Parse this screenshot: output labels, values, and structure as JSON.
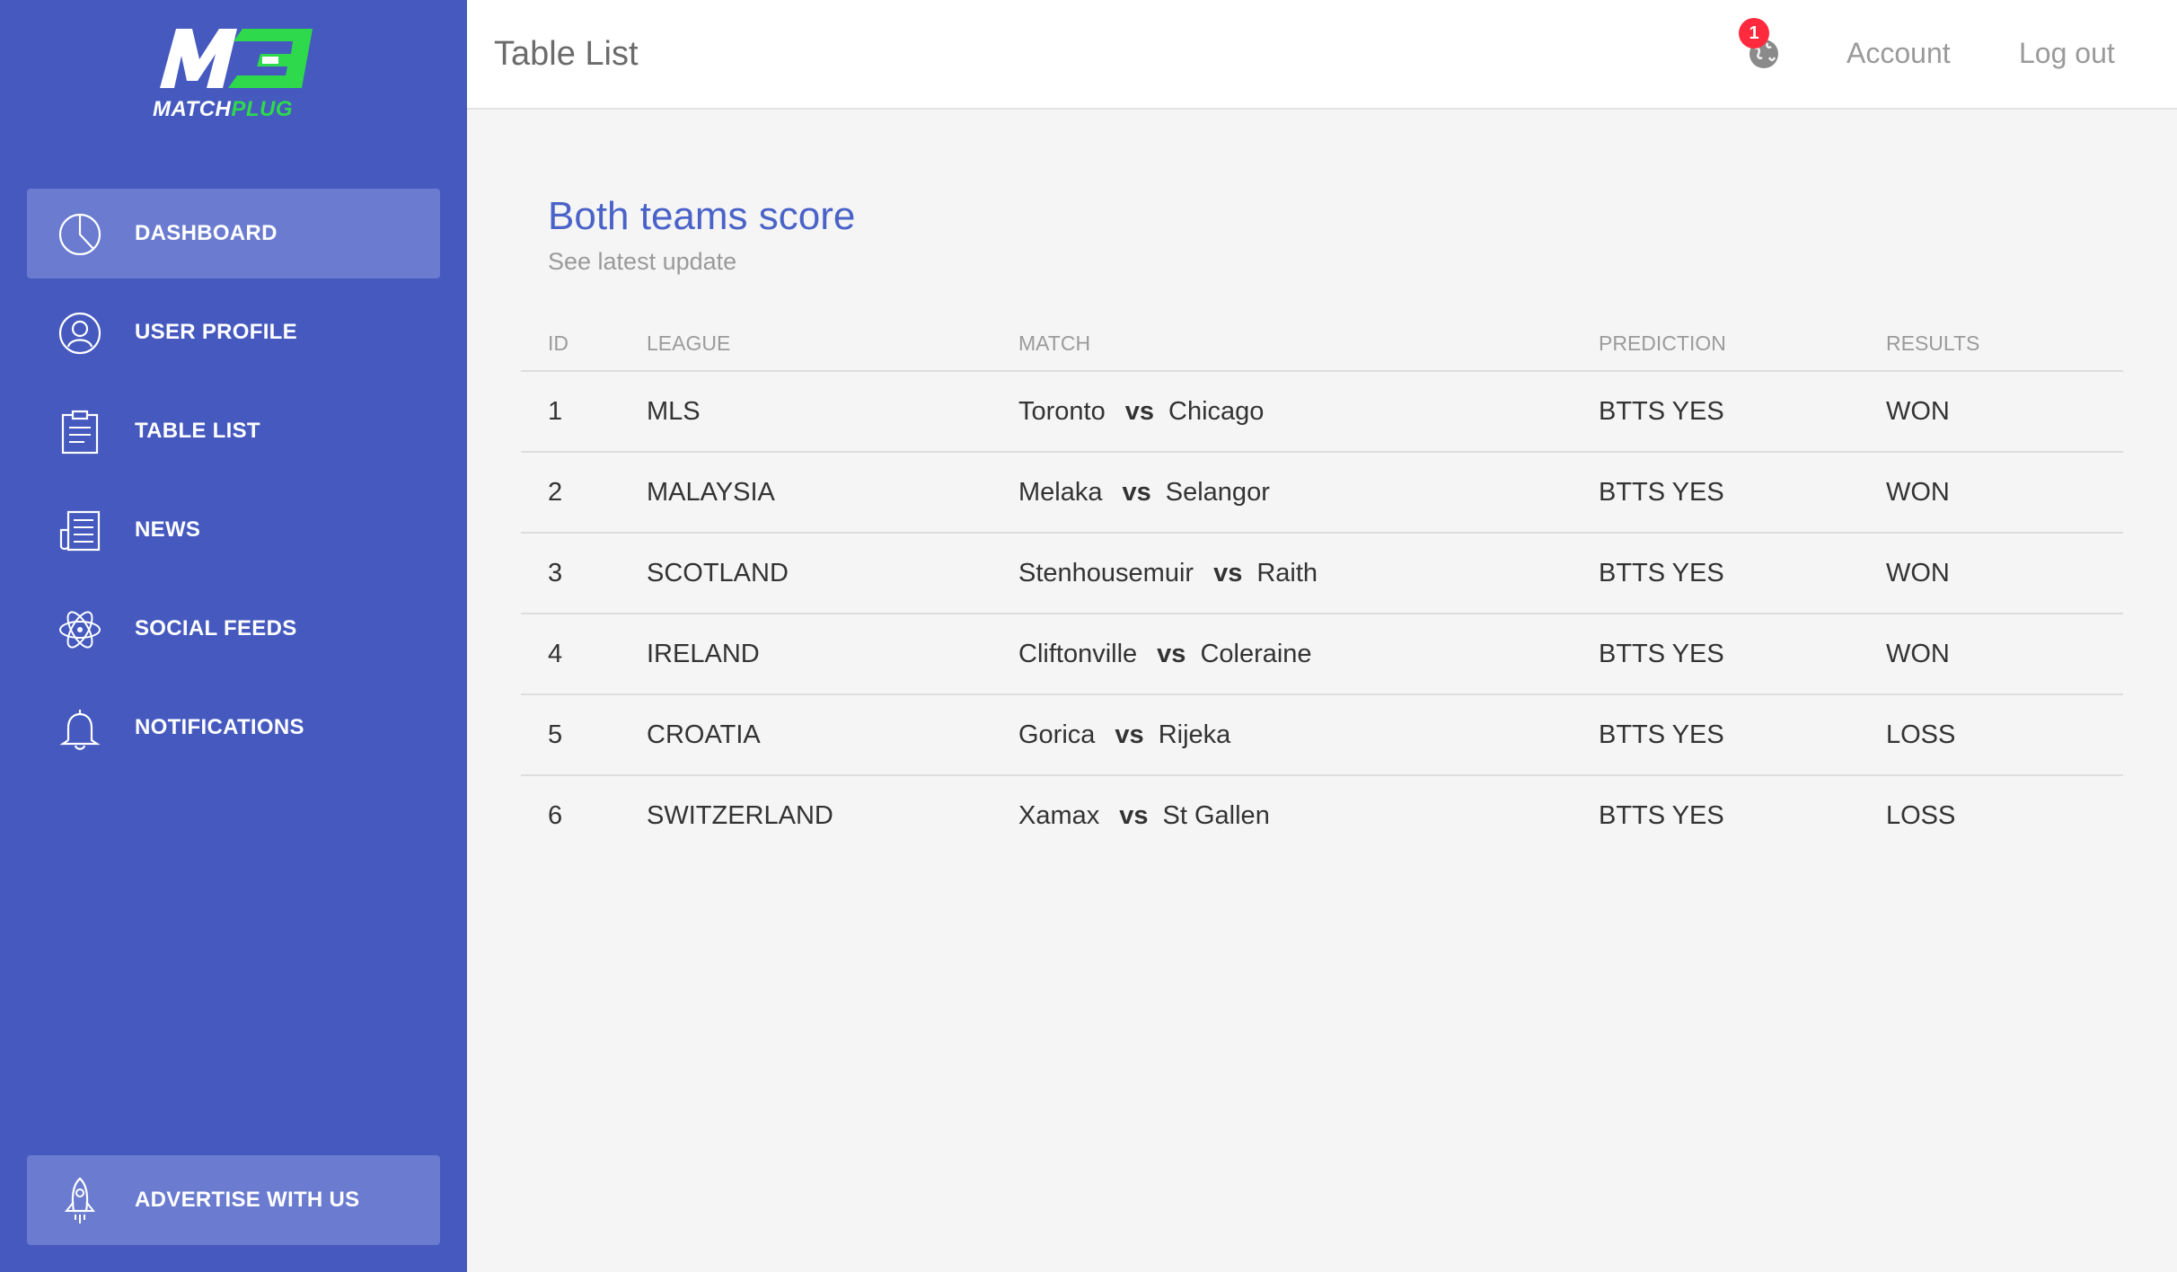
{
  "sidebar": {
    "logo": {
      "brand_part1": "MATCH",
      "brand_part2": "PLUG"
    },
    "items": [
      {
        "label": "DASHBOARD",
        "icon": "pie-chart-icon",
        "active": true
      },
      {
        "label": "USER PROFILE",
        "icon": "user-icon",
        "active": false
      },
      {
        "label": "TABLE LIST",
        "icon": "clipboard-icon",
        "active": false
      },
      {
        "label": "NEWS",
        "icon": "newspaper-icon",
        "active": false
      },
      {
        "label": "SOCIAL FEEDS",
        "icon": "atom-icon",
        "active": false
      },
      {
        "label": "NOTIFICATIONS",
        "icon": "bell-icon",
        "active": false
      }
    ],
    "advertise": {
      "label": "ADVERTISE WITH US",
      "icon": "rocket-icon"
    }
  },
  "header": {
    "title": "Table List",
    "notification_count": "1",
    "globe_icon": "globe-icon",
    "account": "Account",
    "logout": "Log out"
  },
  "card": {
    "title": "Both teams score",
    "subtitle": "See latest update"
  },
  "table": {
    "columns": [
      "ID",
      "LEAGUE",
      "MATCH",
      "PREDICTION",
      "RESULTS"
    ],
    "vs_label": "vs",
    "rows": [
      {
        "id": "1",
        "league": "MLS",
        "home": "Toronto",
        "away": "Chicago",
        "prediction": "BTTS YES",
        "result": "WON"
      },
      {
        "id": "2",
        "league": "MALAYSIA",
        "home": "Melaka",
        "away": "Selangor",
        "prediction": "BTTS YES",
        "result": "WON"
      },
      {
        "id": "3",
        "league": "SCOTLAND",
        "home": "Stenhousemuir",
        "away": "Raith",
        "prediction": "BTTS YES",
        "result": "WON"
      },
      {
        "id": "4",
        "league": "IRELAND",
        "home": "Cliftonville",
        "away": "Coleraine",
        "prediction": "BTTS YES",
        "result": "WON"
      },
      {
        "id": "5",
        "league": "CROATIA",
        "home": "Gorica",
        "away": "Rijeka",
        "prediction": "BTTS YES",
        "result": "LOSS"
      },
      {
        "id": "6",
        "league": "SWITZERLAND",
        "home": "Xamax",
        "away": "St Gallen",
        "prediction": "BTTS YES",
        "result": "LOSS"
      }
    ]
  },
  "colors": {
    "sidebar_bg": "#4559bf",
    "sidebar_active": "#6a7bd0",
    "accent_green": "#2ed94b",
    "title_blue": "#4a63c8",
    "badge_red": "#ff2a3d"
  }
}
